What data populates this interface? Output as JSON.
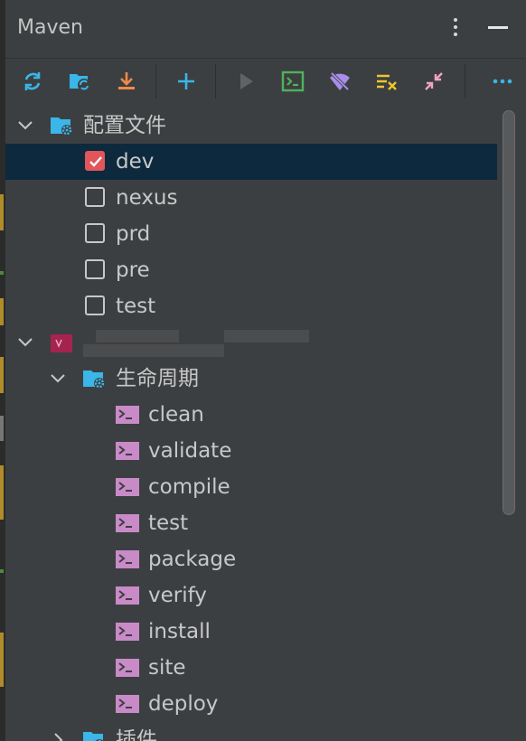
{
  "panel": {
    "title": "Maven"
  },
  "toolbar": {
    "buttons": [
      {
        "name": "reload-icon",
        "color": "#3ab6e8"
      },
      {
        "name": "generate-sources-icon",
        "color": "#3ab6e8"
      },
      {
        "name": "download-icon",
        "color": "#f08a4b"
      },
      {
        "name": "add-icon",
        "color": "#3ab6e8"
      },
      {
        "name": "run-icon",
        "color": "#5f6366"
      },
      {
        "name": "execute-goal-icon",
        "color": "#4fb25c"
      },
      {
        "name": "toggle-offline-icon",
        "color": "#a88ee8"
      },
      {
        "name": "skip-tests-icon",
        "color": "#f0c52d"
      },
      {
        "name": "collapse-all-icon",
        "color": "#f2a3c4"
      },
      {
        "name": "more-icon",
        "color": "#3ab6e8"
      }
    ]
  },
  "tree": {
    "profiles": {
      "label": "配置文件",
      "items": [
        {
          "label": "dev",
          "checked": true
        },
        {
          "label": "nexus",
          "checked": false
        },
        {
          "label": "prd",
          "checked": false
        },
        {
          "label": "pre",
          "checked": false
        },
        {
          "label": "test",
          "checked": false
        }
      ]
    },
    "project": {
      "label": ""
    },
    "lifecycle": {
      "label": "生命周期",
      "goals": [
        "clean",
        "validate",
        "compile",
        "test",
        "package",
        "verify",
        "install",
        "site",
        "deploy"
      ]
    },
    "plugins": {
      "label": "插件"
    }
  },
  "colors": {
    "background": "#3c3f41",
    "selected_row": "#0d293e",
    "checkbox_checked": "#e0565b",
    "goal_icon": "#c98ac8",
    "folder": "#3ab6e8"
  }
}
